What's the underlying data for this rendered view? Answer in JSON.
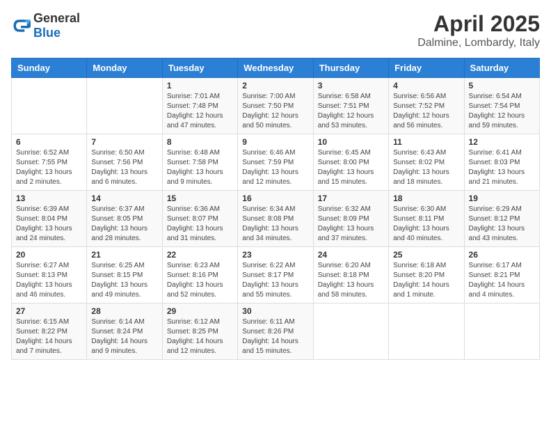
{
  "logo": {
    "general": "General",
    "blue": "Blue"
  },
  "header": {
    "month": "April 2025",
    "location": "Dalmine, Lombardy, Italy"
  },
  "columns": [
    "Sunday",
    "Monday",
    "Tuesday",
    "Wednesday",
    "Thursday",
    "Friday",
    "Saturday"
  ],
  "weeks": [
    [
      {
        "day": "",
        "info": ""
      },
      {
        "day": "",
        "info": ""
      },
      {
        "day": "1",
        "info": "Sunrise: 7:01 AM\nSunset: 7:48 PM\nDaylight: 12 hours and 47 minutes."
      },
      {
        "day": "2",
        "info": "Sunrise: 7:00 AM\nSunset: 7:50 PM\nDaylight: 12 hours and 50 minutes."
      },
      {
        "day": "3",
        "info": "Sunrise: 6:58 AM\nSunset: 7:51 PM\nDaylight: 12 hours and 53 minutes."
      },
      {
        "day": "4",
        "info": "Sunrise: 6:56 AM\nSunset: 7:52 PM\nDaylight: 12 hours and 56 minutes."
      },
      {
        "day": "5",
        "info": "Sunrise: 6:54 AM\nSunset: 7:54 PM\nDaylight: 12 hours and 59 minutes."
      }
    ],
    [
      {
        "day": "6",
        "info": "Sunrise: 6:52 AM\nSunset: 7:55 PM\nDaylight: 13 hours and 2 minutes."
      },
      {
        "day": "7",
        "info": "Sunrise: 6:50 AM\nSunset: 7:56 PM\nDaylight: 13 hours and 6 minutes."
      },
      {
        "day": "8",
        "info": "Sunrise: 6:48 AM\nSunset: 7:58 PM\nDaylight: 13 hours and 9 minutes."
      },
      {
        "day": "9",
        "info": "Sunrise: 6:46 AM\nSunset: 7:59 PM\nDaylight: 13 hours and 12 minutes."
      },
      {
        "day": "10",
        "info": "Sunrise: 6:45 AM\nSunset: 8:00 PM\nDaylight: 13 hours and 15 minutes."
      },
      {
        "day": "11",
        "info": "Sunrise: 6:43 AM\nSunset: 8:02 PM\nDaylight: 13 hours and 18 minutes."
      },
      {
        "day": "12",
        "info": "Sunrise: 6:41 AM\nSunset: 8:03 PM\nDaylight: 13 hours and 21 minutes."
      }
    ],
    [
      {
        "day": "13",
        "info": "Sunrise: 6:39 AM\nSunset: 8:04 PM\nDaylight: 13 hours and 24 minutes."
      },
      {
        "day": "14",
        "info": "Sunrise: 6:37 AM\nSunset: 8:05 PM\nDaylight: 13 hours and 28 minutes."
      },
      {
        "day": "15",
        "info": "Sunrise: 6:36 AM\nSunset: 8:07 PM\nDaylight: 13 hours and 31 minutes."
      },
      {
        "day": "16",
        "info": "Sunrise: 6:34 AM\nSunset: 8:08 PM\nDaylight: 13 hours and 34 minutes."
      },
      {
        "day": "17",
        "info": "Sunrise: 6:32 AM\nSunset: 8:09 PM\nDaylight: 13 hours and 37 minutes."
      },
      {
        "day": "18",
        "info": "Sunrise: 6:30 AM\nSunset: 8:11 PM\nDaylight: 13 hours and 40 minutes."
      },
      {
        "day": "19",
        "info": "Sunrise: 6:29 AM\nSunset: 8:12 PM\nDaylight: 13 hours and 43 minutes."
      }
    ],
    [
      {
        "day": "20",
        "info": "Sunrise: 6:27 AM\nSunset: 8:13 PM\nDaylight: 13 hours and 46 minutes."
      },
      {
        "day": "21",
        "info": "Sunrise: 6:25 AM\nSunset: 8:15 PM\nDaylight: 13 hours and 49 minutes."
      },
      {
        "day": "22",
        "info": "Sunrise: 6:23 AM\nSunset: 8:16 PM\nDaylight: 13 hours and 52 minutes."
      },
      {
        "day": "23",
        "info": "Sunrise: 6:22 AM\nSunset: 8:17 PM\nDaylight: 13 hours and 55 minutes."
      },
      {
        "day": "24",
        "info": "Sunrise: 6:20 AM\nSunset: 8:18 PM\nDaylight: 13 hours and 58 minutes."
      },
      {
        "day": "25",
        "info": "Sunrise: 6:18 AM\nSunset: 8:20 PM\nDaylight: 14 hours and 1 minute."
      },
      {
        "day": "26",
        "info": "Sunrise: 6:17 AM\nSunset: 8:21 PM\nDaylight: 14 hours and 4 minutes."
      }
    ],
    [
      {
        "day": "27",
        "info": "Sunrise: 6:15 AM\nSunset: 8:22 PM\nDaylight: 14 hours and 7 minutes."
      },
      {
        "day": "28",
        "info": "Sunrise: 6:14 AM\nSunset: 8:24 PM\nDaylight: 14 hours and 9 minutes."
      },
      {
        "day": "29",
        "info": "Sunrise: 6:12 AM\nSunset: 8:25 PM\nDaylight: 14 hours and 12 minutes."
      },
      {
        "day": "30",
        "info": "Sunrise: 6:11 AM\nSunset: 8:26 PM\nDaylight: 14 hours and 15 minutes."
      },
      {
        "day": "",
        "info": ""
      },
      {
        "day": "",
        "info": ""
      },
      {
        "day": "",
        "info": ""
      }
    ]
  ]
}
